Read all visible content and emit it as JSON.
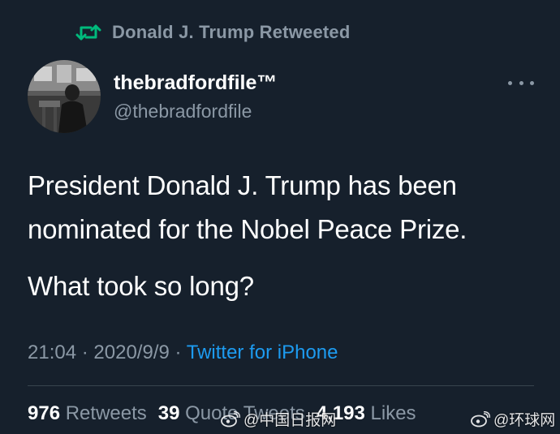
{
  "retweet": {
    "icon": "retweet-icon",
    "text": "Donald J. Trump Retweeted"
  },
  "author": {
    "name": "thebradfordfile™",
    "handle": "@thebradfordfile",
    "avatar_icon": "profile-photo"
  },
  "more_icon": "more-options-icon",
  "tweet": {
    "lines": [
      "President Donald J. Trump has been",
      "nominated for the Nobel Peace Prize.",
      "What took so long?"
    ]
  },
  "meta": {
    "time": "21:04",
    "date": "2020/9/9",
    "separator": "·",
    "source": "Twitter for iPhone"
  },
  "stats": {
    "retweets_count": "976",
    "retweets_label": "Retweets",
    "quote_count": "39",
    "quote_label": "Quote Tweets",
    "likes_count": "4,193",
    "likes_label": "Likes"
  },
  "watermarks": [
    {
      "text": "@中国日报网",
      "icon": "weibo-logo"
    },
    {
      "text": "@环球网",
      "icon": "weibo-logo"
    }
  ],
  "colors": {
    "background": "#16202c",
    "secondary_text": "#8b98a5",
    "link": "#1d9bf0",
    "retweet_green": "#00ba7c",
    "divider": "#38444d"
  }
}
